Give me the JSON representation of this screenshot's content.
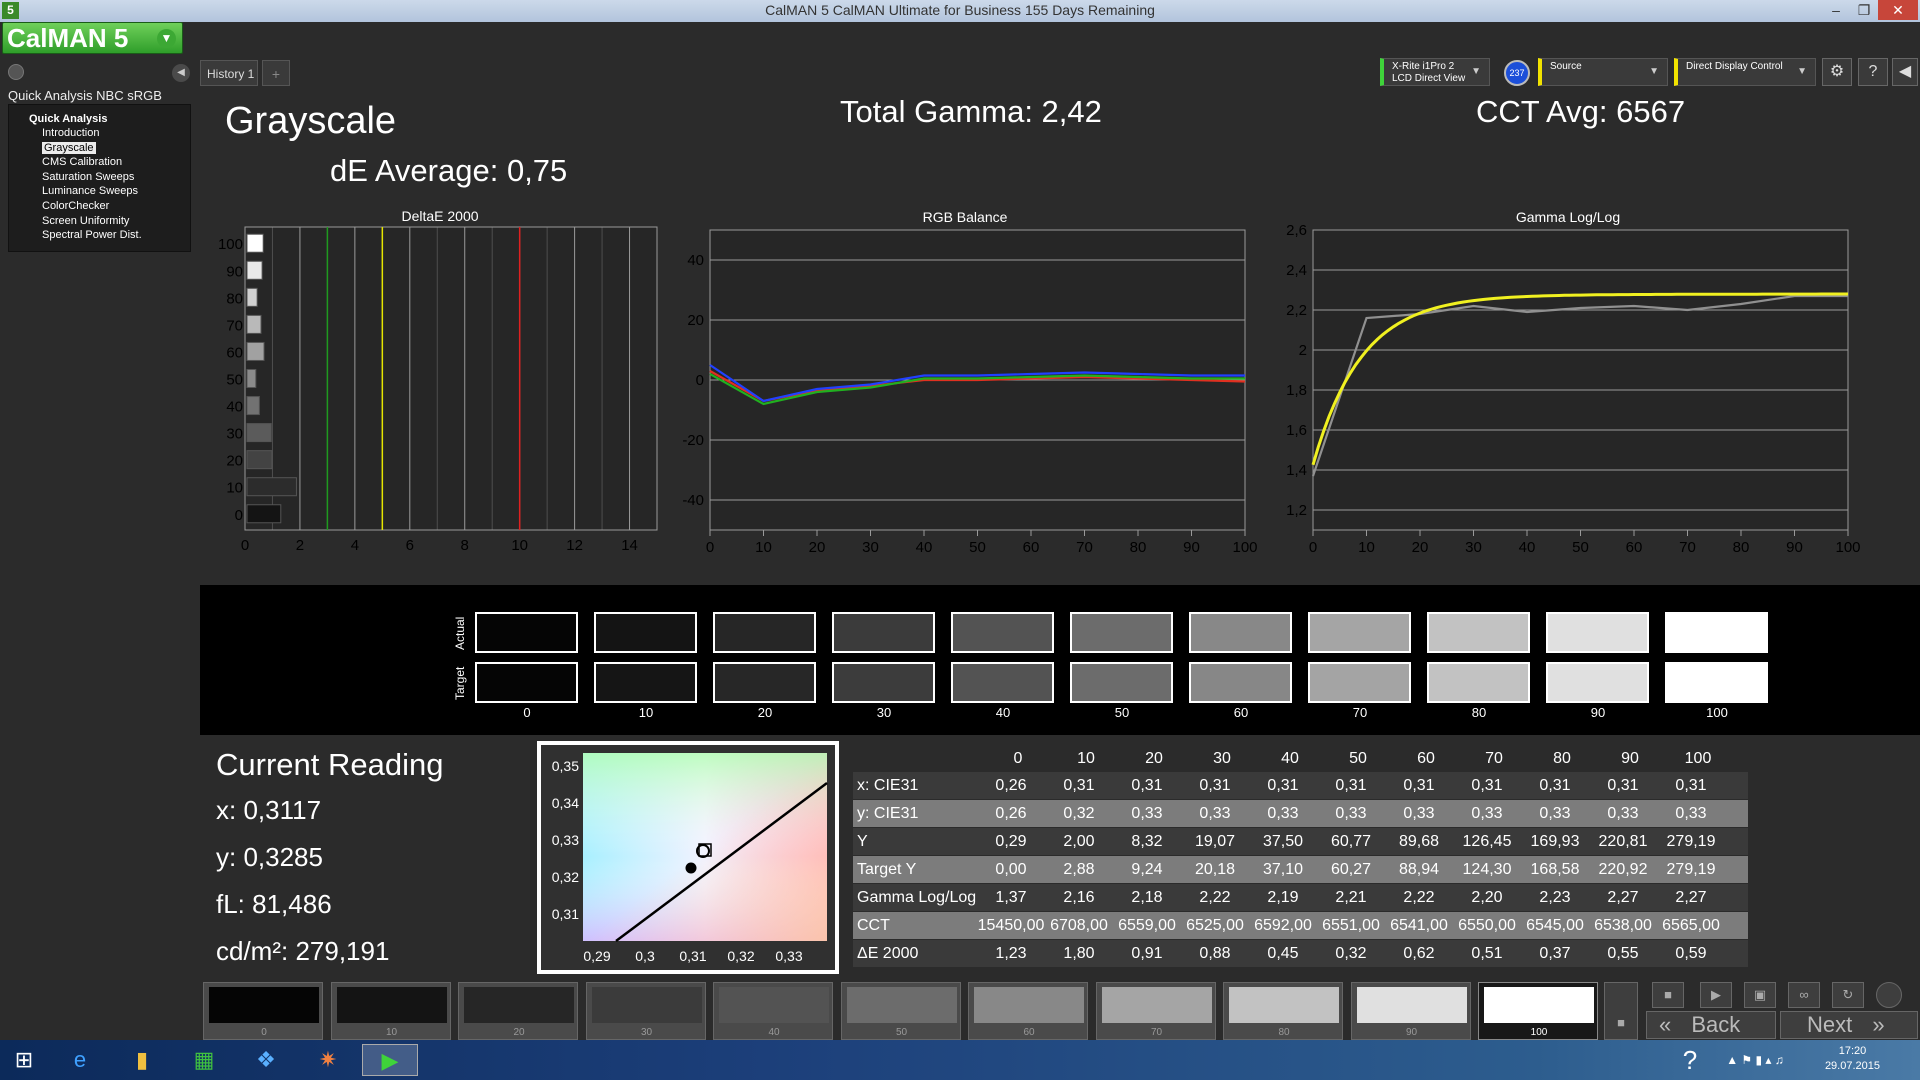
{
  "window": {
    "title": "CalMAN 5 CalMAN Ultimate for Business 155 Days Remaining",
    "app_icon": "5"
  },
  "toolbar": {
    "logo": "CalMAN 5",
    "history_tab": "History 1",
    "meter_line1": "X-Rite i1Pro 2",
    "meter_line2": "LCD Direct View",
    "meter_badge": "237",
    "source_label": "Source",
    "display_label": "Direct Display Control"
  },
  "sidebar": {
    "title": "Quick Analysis NBC sRGB",
    "group": "Quick Analysis",
    "items": [
      "Introduction",
      "Grayscale",
      "CMS Calibration",
      "Saturation Sweeps",
      "Luminance Sweeps",
      "ColorChecker",
      "Screen Uniformity",
      "Spectral Power Dist."
    ],
    "selected_index": 1
  },
  "main": {
    "heading": "Grayscale",
    "de_average": "dE Average: 0,75",
    "total_gamma": "Total Gamma: 2,42",
    "cct_avg": "CCT Avg: 6567"
  },
  "chart_data": [
    {
      "type": "bar",
      "title": "DeltaE 2000",
      "orientation": "horizontal",
      "categories": [
        "0",
        "10",
        "20",
        "30",
        "40",
        "50",
        "60",
        "70",
        "80",
        "90",
        "100"
      ],
      "values": [
        1.23,
        1.8,
        0.91,
        0.88,
        0.45,
        0.32,
        0.62,
        0.51,
        0.37,
        0.55,
        0.59
      ],
      "xlim": [
        0,
        15
      ],
      "x_ticks": [
        "0",
        "2",
        "4",
        "6",
        "8",
        "10",
        "12",
        "14"
      ],
      "threshold_lines": [
        {
          "value": 3,
          "color": "#1f9a1f"
        },
        {
          "value": 5,
          "color": "#e6e600"
        },
        {
          "value": 10,
          "color": "#e02020"
        }
      ]
    },
    {
      "type": "line",
      "title": "RGB Balance",
      "x": [
        0,
        10,
        20,
        30,
        40,
        50,
        60,
        70,
        80,
        90,
        100
      ],
      "series": [
        {
          "color": "#e03020",
          "values": [
            3,
            -7,
            -3.5,
            -2,
            0,
            0,
            0.5,
            1,
            0.5,
            0,
            -0.5
          ]
        },
        {
          "color": "#20b020",
          "values": [
            2,
            -8,
            -4,
            -2.5,
            0.5,
            0.5,
            1,
            1.5,
            1,
            0.5,
            0.5
          ]
        },
        {
          "color": "#2040ff",
          "values": [
            5,
            -7,
            -3,
            -1.5,
            1.5,
            1.5,
            2,
            2.5,
            2,
            1.5,
            1.5
          ]
        }
      ],
      "ylim": [
        -50,
        50
      ],
      "y_ticks": [
        "40",
        "20",
        "0",
        "-20",
        "-40"
      ],
      "x_ticks": [
        "0",
        "10",
        "20",
        "30",
        "40",
        "50",
        "60",
        "70",
        "80",
        "90",
        "100"
      ]
    },
    {
      "type": "line",
      "title": "Gamma Log/Log",
      "x": [
        0,
        10,
        20,
        30,
        40,
        50,
        60,
        70,
        80,
        90,
        100
      ],
      "series": [
        {
          "color": "#909090",
          "values": [
            1.37,
            2.16,
            2.18,
            2.22,
            2.19,
            2.21,
            2.22,
            2.2,
            2.23,
            2.27,
            2.27
          ]
        },
        {
          "color": "#f0f020",
          "curve": "target",
          "values": [
            1.4,
            1.95,
            2.1,
            2.17,
            2.2,
            2.22,
            2.24,
            2.25,
            2.26,
            2.27,
            2.28
          ]
        }
      ],
      "ylim": [
        1.1,
        2.6
      ],
      "y_ticks": [
        "2,6",
        "2,4",
        "2,2",
        "2",
        "1,8",
        "1,6",
        "1,4",
        "1,2"
      ],
      "x_ticks": [
        "0",
        "10",
        "20",
        "30",
        "40",
        "50",
        "60",
        "70",
        "80",
        "90",
        "100"
      ]
    }
  ],
  "swatches": {
    "labels": [
      "0",
      "10",
      "20",
      "30",
      "40",
      "50",
      "60",
      "70",
      "80",
      "90",
      "100"
    ],
    "actual_label": "Actual",
    "target_label": "Target",
    "actual_colors": [
      "#050505",
      "#141414",
      "#262626",
      "#3b3b3b",
      "#535353",
      "#6c6c6c",
      "#888888",
      "#a5a5a5",
      "#c2c2c2",
      "#e0e0e0",
      "#ffffff"
    ],
    "target_colors": [
      "#050505",
      "#151515",
      "#272727",
      "#3c3c3c",
      "#535353",
      "#6c6c6c",
      "#878787",
      "#a4a4a4",
      "#c2c2c2",
      "#e0e0e0",
      "#ffffff"
    ]
  },
  "reading": {
    "title": "Current Reading",
    "x": "x: 0,3117",
    "y": "y: 0,3285",
    "fl": "fL: 81,486",
    "cdm2": "cd/m²: 279,191"
  },
  "cie": {
    "x_ticks": [
      "0,29",
      "0,3",
      "0,31",
      "0,32",
      "0,33"
    ],
    "y_ticks": [
      "0,35",
      "0,34",
      "0,33",
      "0,32",
      "0,31"
    ]
  },
  "table": {
    "columns": [
      "0",
      "10",
      "20",
      "30",
      "40",
      "50",
      "60",
      "70",
      "80",
      "90",
      "100"
    ],
    "rows": [
      {
        "label": "x: CIE31",
        "values": [
          "0,26",
          "0,31",
          "0,31",
          "0,31",
          "0,31",
          "0,31",
          "0,31",
          "0,31",
          "0,31",
          "0,31",
          "0,31"
        ]
      },
      {
        "label": "y: CIE31",
        "values": [
          "0,26",
          "0,32",
          "0,33",
          "0,33",
          "0,33",
          "0,33",
          "0,33",
          "0,33",
          "0,33",
          "0,33",
          "0,33"
        ]
      },
      {
        "label": "Y",
        "values": [
          "0,29",
          "2,00",
          "8,32",
          "19,07",
          "37,50",
          "60,77",
          "89,68",
          "126,45",
          "169,93",
          "220,81",
          "279,19"
        ]
      },
      {
        "label": "Target Y",
        "values": [
          "0,00",
          "2,88",
          "9,24",
          "20,18",
          "37,10",
          "60,27",
          "88,94",
          "124,30",
          "168,58",
          "220,92",
          "279,19"
        ]
      },
      {
        "label": "Gamma Log/Log",
        "values": [
          "1,37",
          "2,16",
          "2,18",
          "2,22",
          "2,19",
          "2,21",
          "2,22",
          "2,20",
          "2,23",
          "2,27",
          "2,27"
        ]
      },
      {
        "label": "CCT",
        "values": [
          "15450,00",
          "6708,00",
          "6559,00",
          "6525,00",
          "6592,00",
          "6551,00",
          "6541,00",
          "6550,00",
          "6545,00",
          "6538,00",
          "6565,00"
        ]
      },
      {
        "label": "ΔE 2000",
        "values": [
          "1,23",
          "1,80",
          "0,91",
          "0,88",
          "0,45",
          "0,32",
          "0,62",
          "0,51",
          "0,37",
          "0,55",
          "0,59"
        ]
      }
    ]
  },
  "bottom": {
    "labels": [
      "0",
      "10",
      "20",
      "30",
      "40",
      "50",
      "60",
      "70",
      "80",
      "90",
      "100"
    ],
    "colors": [
      "#050505",
      "#141414",
      "#262626",
      "#3b3b3b",
      "#535353",
      "#6c6c6c",
      "#888888",
      "#a5a5a5",
      "#c2c2c2",
      "#e0e0e0",
      "#ffffff"
    ],
    "selected_index": 10,
    "back_label": "Back",
    "next_label": "Next"
  },
  "taskbar": {
    "time": "17:20",
    "date": "29.07.2015"
  }
}
